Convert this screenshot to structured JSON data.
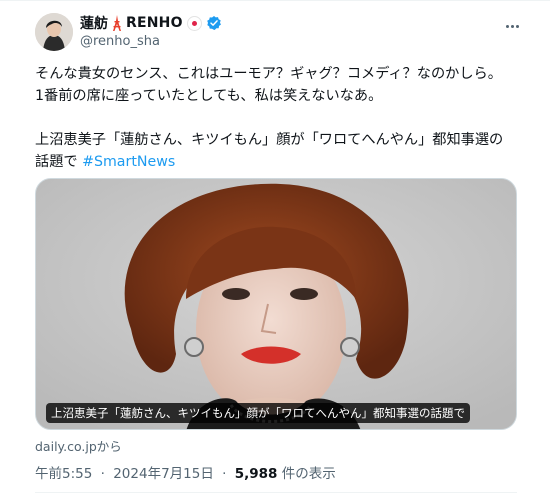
{
  "author": {
    "display_name": "蓮舫",
    "brand_name": "RENHO",
    "handle": "@renho_sha",
    "icons": [
      "tokyo-tower-emoji",
      "japan-flag-emoji",
      "verified-badge-icon"
    ],
    "colors": {
      "verified": "#1d9bf0",
      "flag_red": "#e0244a"
    }
  },
  "tweet": {
    "lines": [
      "そんな貴女のセンス、これはユーモア？ギャグ？コメディ？なのかしら。",
      "1番前の席に座っていたとしても、私は笑えないなあ。"
    ],
    "article_line_1": "上沼恵美子「蓮舫さん、キツイもん」顔が「ワロてへんやん」都知事選の",
    "article_line_2_prefix": "話題で",
    "hashtag": "#SmartNews"
  },
  "card": {
    "caption": "上沼恵美子「蓮舫さん、キツイもん」顔が「ワロてへんやん」都知事選の話題で",
    "source": "daily.co.jpから"
  },
  "meta": {
    "time": "午前5:55",
    "date": "2024年7月15日",
    "separator": "·",
    "views_count": "5,988",
    "views_label": "件の表示"
  }
}
